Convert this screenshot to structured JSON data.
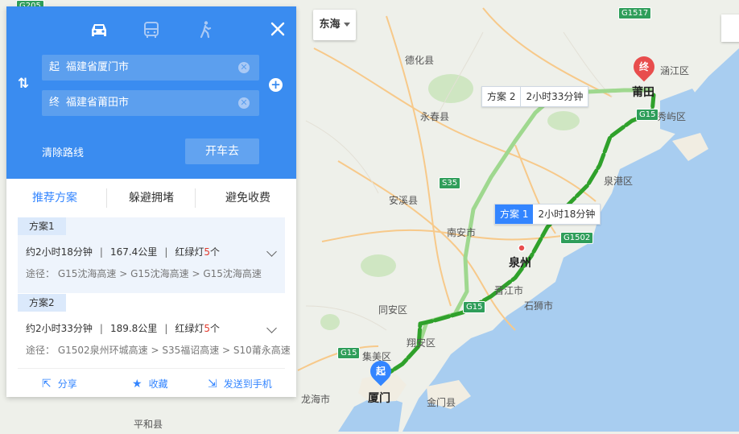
{
  "map": {
    "city_selector": "东海",
    "labels": [
      {
        "text": "德化县",
        "kind": "district"
      },
      {
        "text": "永春县",
        "kind": "district"
      },
      {
        "text": "安溪县",
        "kind": "district"
      },
      {
        "text": "南安市",
        "kind": "district"
      },
      {
        "text": "泉州",
        "kind": "city"
      },
      {
        "text": "晋江市",
        "kind": "district"
      },
      {
        "text": "石狮市",
        "kind": "district"
      },
      {
        "text": "同安区",
        "kind": "district"
      },
      {
        "text": "翔安区",
        "kind": "district"
      },
      {
        "text": "集美区",
        "kind": "district"
      },
      {
        "text": "厦门",
        "kind": "city"
      },
      {
        "text": "金门县",
        "kind": "district"
      },
      {
        "text": "龙海市",
        "kind": "district"
      },
      {
        "text": "平和县",
        "kind": "district"
      },
      {
        "text": "莆田",
        "kind": "city"
      },
      {
        "text": "涵江区",
        "kind": "district"
      },
      {
        "text": "秀屿区",
        "kind": "district"
      },
      {
        "text": "泉港区",
        "kind": "district"
      }
    ],
    "road_shields": [
      "G1517",
      "G15",
      "S35",
      "G1502",
      "G15",
      "G15",
      "G205"
    ],
    "route_tags": [
      {
        "plan": "方案 1",
        "time": "2小时18分钟"
      },
      {
        "plan": "方案 2",
        "time": "2小时33分钟"
      }
    ],
    "markers": {
      "start": "起",
      "end": "终"
    },
    "colors": {
      "primary_route": "#2fa12b",
      "alt_route": "#9fd88f",
      "accent": "#3385ff",
      "panel_header": "#3a8cf0"
    }
  },
  "panel": {
    "modes": [
      {
        "icon": "car-icon",
        "active": true
      },
      {
        "icon": "bus-icon",
        "active": false
      },
      {
        "icon": "walk-icon",
        "active": false
      }
    ],
    "start": {
      "label": "起",
      "value": "福建省厦门市"
    },
    "end": {
      "label": "终",
      "value": "福建省莆田市"
    },
    "clear_route": "清除路线",
    "go_button": "开车去",
    "tabs": [
      "推荐方案",
      "躲避拥堵",
      "避免收费"
    ],
    "plans": [
      {
        "badge": "方案1",
        "time": "约2小时18分钟",
        "distance": "167.4公里",
        "lights_prefix": "红绿灯",
        "lights": "5",
        "lights_suffix": "个",
        "via": "途径： G15沈海高速 > G15沈海高速 > G15沈海高速"
      },
      {
        "badge": "方案2",
        "time": "约2小时33分钟",
        "distance": "189.8公里",
        "lights_prefix": "红绿灯",
        "lights": "5",
        "lights_suffix": "个",
        "via": "途径： G1502泉州环城高速 > S35福诏高速 > S10莆永高速"
      }
    ],
    "actions": {
      "share": "分享",
      "favorite": "收藏",
      "send": "发送到手机"
    }
  }
}
